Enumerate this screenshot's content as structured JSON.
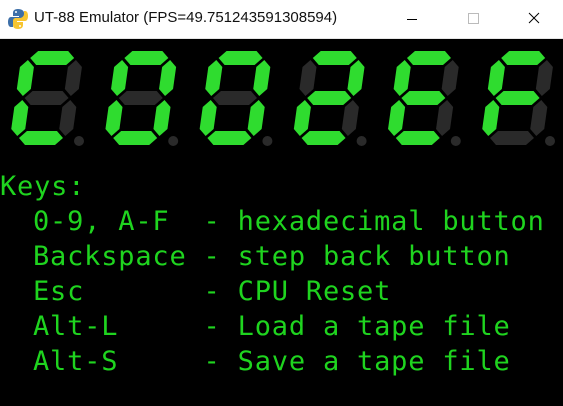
{
  "window": {
    "title": "UT-88 Emulator (FPS=49.751243591308594)",
    "icon": "python-icon"
  },
  "display": {
    "digit_count": 6,
    "digits": [
      "C",
      "0",
      "0",
      "2",
      "E",
      "F"
    ],
    "lit_color": "#2fdc2f",
    "unlit_color": "#2a2a2a"
  },
  "help": {
    "heading": "Keys:",
    "rows": [
      {
        "key": "0-9, A-F ",
        "sep": " - ",
        "desc": "hexadecimal button"
      },
      {
        "key": "Backspace",
        "sep": " - ",
        "desc": "step back button"
      },
      {
        "key": "Esc      ",
        "sep": " - ",
        "desc": "CPU Reset"
      },
      {
        "key": "Alt-L    ",
        "sep": " - ",
        "desc": "Load a tape file"
      },
      {
        "key": "Alt-S    ",
        "sep": " - ",
        "desc": "Save a tape file"
      }
    ],
    "text_color": "#1fd41f"
  }
}
